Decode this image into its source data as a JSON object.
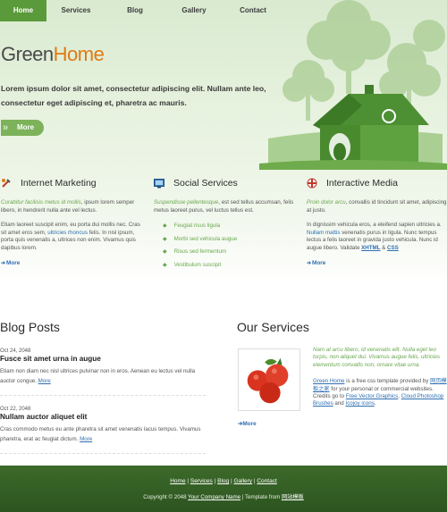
{
  "nav": {
    "items": [
      "Home",
      "Services",
      "Blog",
      "Gallery",
      "Contact"
    ],
    "active": "Home"
  },
  "hero": {
    "logo_part1": "Green",
    "logo_part2": "Home",
    "text": "Lorem ipsum dolor sit amet, consectetur adipiscing elit. Nullam ante leo, consectetur eget adipiscing et, pharetra ac mauris.",
    "more_label": "More"
  },
  "features": {
    "internet_marketing": {
      "title": "Internet Marketing",
      "intro_em": "Curabitur facilisis metus id mollis",
      "intro_rest": ", ipsum lorem semper libero, in hendrerit nulla ante vel lectus.",
      "body_pre": "Etiam laoreet suscipit enim, eu porta dui mollis nec. Cras sit amet eros sem, ",
      "body_link": "ultricies rhoncus",
      "body_post": " felis. In nisl ipsum, porta quis venenatis a, ultrices non enim. Vivamus quis dapibus lorem.",
      "more": "More"
    },
    "social_services": {
      "title": "Social Services",
      "intro_em": "Suspendisse pellentesque",
      "intro_rest": ", est sed tellus accumsan, felis metus laoreet purus, vel luctus tellus est.",
      "bullets": [
        "Feugiat risus ligula",
        "Morbi sed vehicula augue",
        "Risus sed fermentum",
        "Vestibulum suscipit"
      ]
    },
    "interactive_media": {
      "title": "Interactive Media",
      "intro_em": "Proin dolor arcu",
      "intro_rest": ", convallis id tincidunt sit amet, adipiscing at justo.",
      "body_pre": "In dignissim vehicula eros, a eleifend sapien ultricies a. ",
      "body_link": "Nullam mattis",
      "body_mid": " venenatis purus in ligula. Nunc tempus lectus a felis laoreet in gravida justo vehicula. Nunc id augue libero. Validate ",
      "xhtml": "XHTML",
      "amp": " & ",
      "css": "CSS",
      "more": "More"
    }
  },
  "blog": {
    "title": "Blog Posts",
    "posts": [
      {
        "date": "Oct 24, 2048",
        "title": "Fusce sit amet urna in augue",
        "body": "Etiam non diam nec nisl ultrices pulvinar non in eros. Aenean eu lectus vel nulla auctor congue. ",
        "more": "More"
      },
      {
        "date": "Oct 22, 2048",
        "title": "Nullam auctor aliquet elit",
        "body": "Cras commodo metus eu ante pharetra sit amet venenatis lacus tempus. Vivamus pharetra, erat ac feugiat dictum. ",
        "more": "More"
      }
    ]
  },
  "services": {
    "title": "Our Services",
    "em_text": "Nam at arcu libero, id venenatis elit. Nulla eget leo turpis, non aliquet dui. Vivamus augue felis, ultricies elementum convallis non, ornare vitae urna.",
    "p2_link1": "Green Home",
    "p2_a": " is a free css template provided by ",
    "p2_link2": "网页模板之家",
    "p2_b": " for your personal or commercial websites. Credits go to ",
    "p2_link3": "Free Vector Graphics",
    "p2_c": ", ",
    "p2_link4": "Cloud Photoshop Brushes",
    "p2_d": " and ",
    "p2_link5": "Icojoy icons",
    "p2_e": ".",
    "more": "More"
  },
  "footer": {
    "links": [
      "Home",
      "Services",
      "Blog",
      "Gallery",
      "Contact"
    ],
    "sep": " | ",
    "copy_pre": "Copyright © 2048 ",
    "copy_link": "Your Company Name",
    "copy_mid": " | Template from ",
    "copy_link2": "网站模板"
  },
  "colors": {
    "accent": "#5b9a3a",
    "logo_orange": "#e07a12",
    "link": "#2f6fb2",
    "em_green": "#6aa84f",
    "footer": "#2c5420"
  }
}
